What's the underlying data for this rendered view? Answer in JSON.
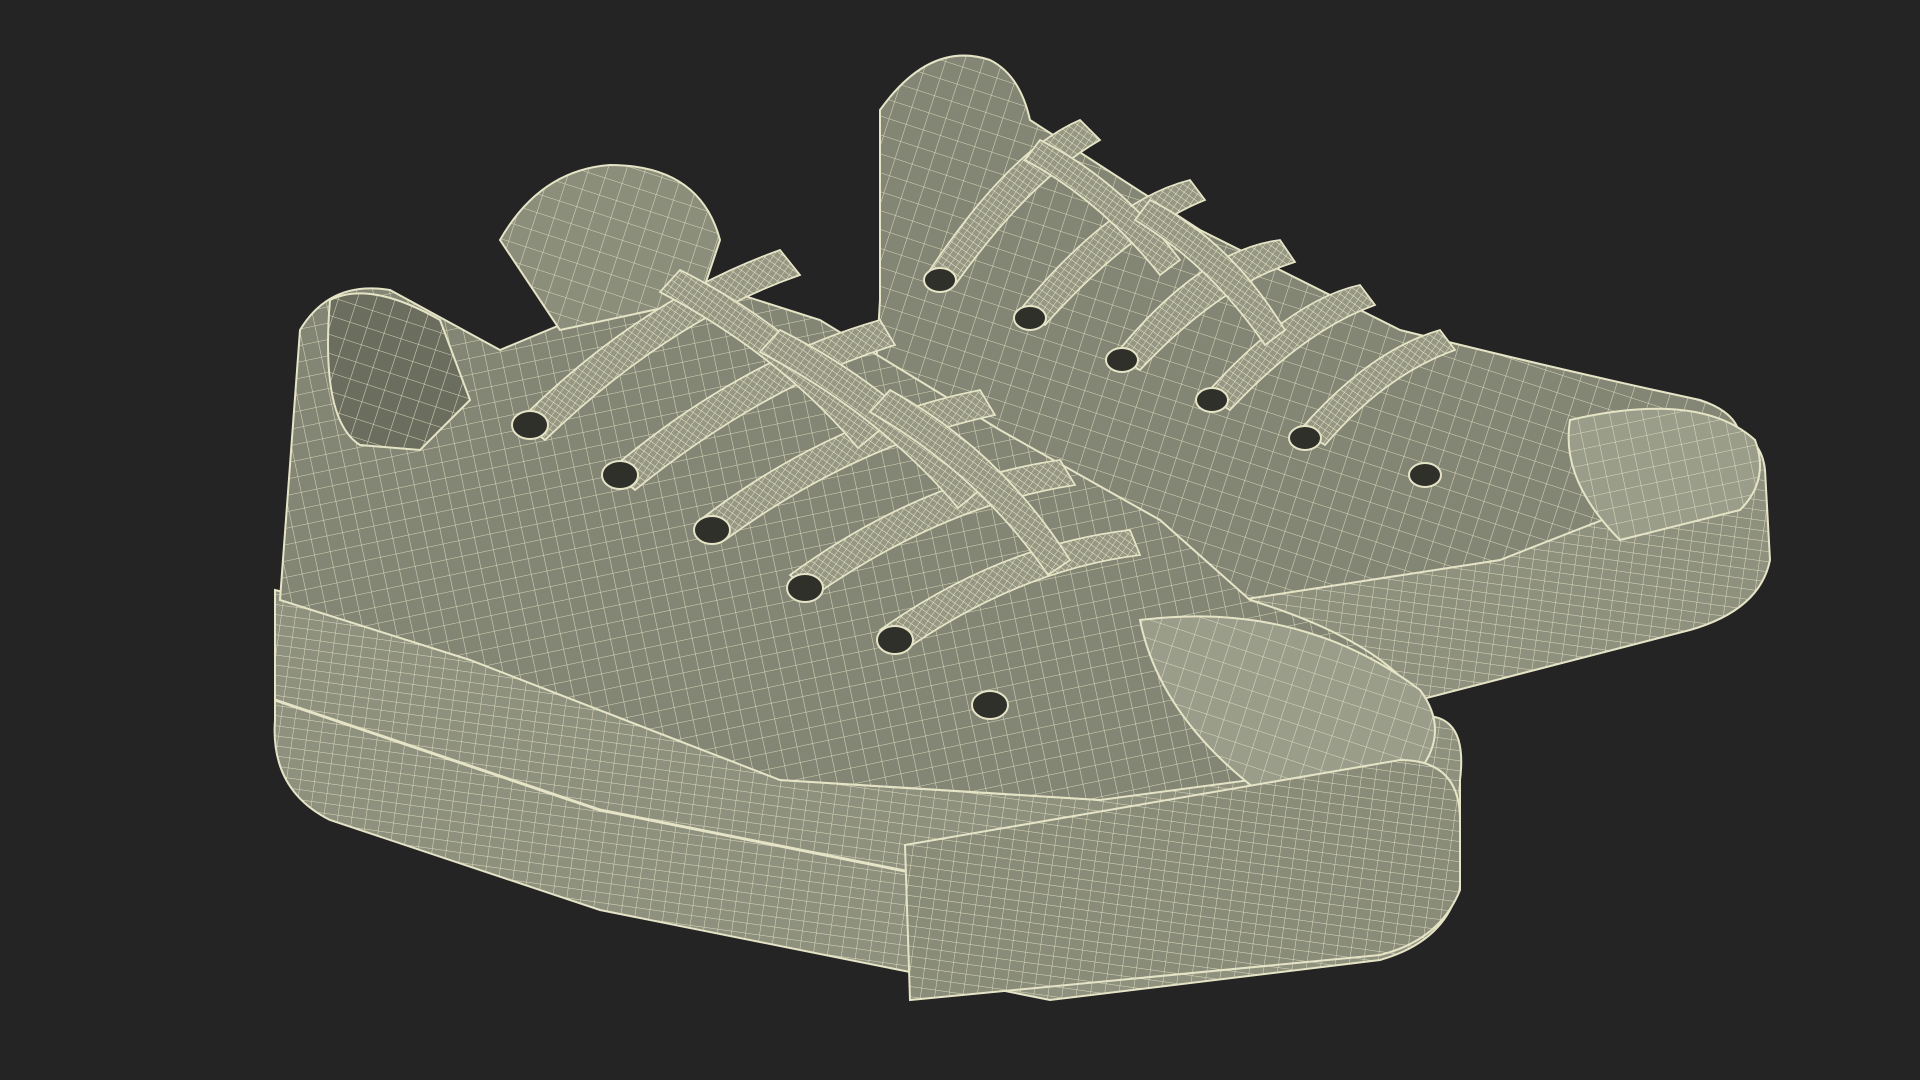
{
  "scene": {
    "subject": "pair-of-low-top-sneakers-wireframe",
    "colors": {
      "background": "#242424",
      "shoe_fill": "#838674",
      "shoe_fill_shadow": "#6b6e5e",
      "shoe_fill_light": "#9a9d8a",
      "wire": "#e6e4c6",
      "eyelet_dark": "#2f302a",
      "sole_fill": "#8f917f"
    },
    "shoes": [
      {
        "name": "back-shoe",
        "eyelets": 6
      },
      {
        "name": "front-shoe",
        "eyelets": 6
      }
    ]
  }
}
